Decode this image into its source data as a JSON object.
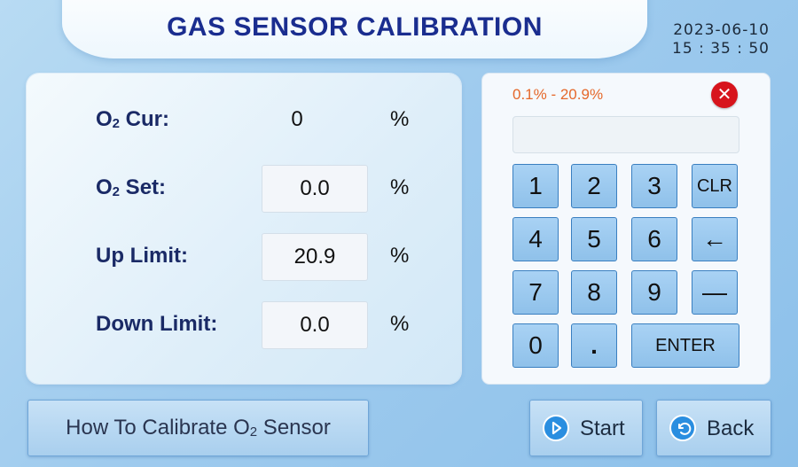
{
  "header": {
    "title": "GAS SENSOR CALIBRATION",
    "date": "2023-06-10",
    "time": "15 : 35 : 50"
  },
  "form": {
    "rows": [
      {
        "label_prefix": "O",
        "label_sub": "2",
        "label_suffix": " Cur:",
        "value": "0",
        "unit": "%"
      },
      {
        "label_prefix": "O",
        "label_sub": "2",
        "label_suffix": " Set:",
        "value": "0.0",
        "unit": "%"
      },
      {
        "label_prefix": "Up Limit:",
        "label_sub": "",
        "label_suffix": "",
        "value": "20.9",
        "unit": "%"
      },
      {
        "label_prefix": "Down Limit:",
        "label_sub": "",
        "label_suffix": "",
        "value": "0.0",
        "unit": "%"
      }
    ]
  },
  "keypad": {
    "range": "0.1% - 20.9%",
    "entry_value": "",
    "keys": {
      "k1": "1",
      "k2": "2",
      "k3": "3",
      "clr": "CLR",
      "k4": "4",
      "k5": "5",
      "k6": "6",
      "backspace": "←",
      "k7": "7",
      "k8": "8",
      "k9": "9",
      "minus": "—",
      "k0": "0",
      "dot": ".",
      "enter": "ENTER"
    }
  },
  "buttons": {
    "how_prefix": "How To Calibrate O",
    "how_sub": "2",
    "how_suffix": " Sensor",
    "start": "Start",
    "back": "Back"
  },
  "icons": {
    "close": "close-icon",
    "start": "play-icon",
    "back": "undo-arrow-icon"
  },
  "colors": {
    "title": "#1a2d8f",
    "range_text": "#e5682a",
    "close_button": "#d7141c",
    "key_fill": "#a9d2f4",
    "icon_blue": "#2a8ee0"
  }
}
